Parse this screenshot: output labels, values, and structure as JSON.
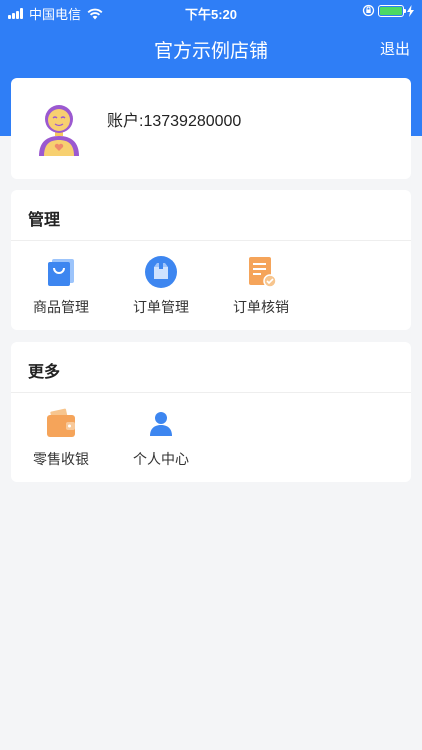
{
  "status_bar": {
    "carrier": "中国电信",
    "time": "下午5:20",
    "battery_color": "#4cd964"
  },
  "nav": {
    "title": "官方示例店铺",
    "logout": "退出"
  },
  "account": {
    "label": "账户:13739280000",
    "avatar_icon": "user-avatar-icon"
  },
  "sections": {
    "manage": {
      "title": "管理",
      "items": [
        {
          "label": "商品管理",
          "icon": "shopping-bag-icon"
        },
        {
          "label": "订单管理",
          "icon": "order-box-icon"
        },
        {
          "label": "订单核销",
          "icon": "order-verify-icon"
        }
      ]
    },
    "more": {
      "title": "更多",
      "items": [
        {
          "label": "零售收银",
          "icon": "wallet-icon"
        },
        {
          "label": "个人中心",
          "icon": "person-icon"
        }
      ]
    }
  },
  "colors": {
    "primary": "#2f7ef6",
    "background": "#f4f5f7"
  }
}
